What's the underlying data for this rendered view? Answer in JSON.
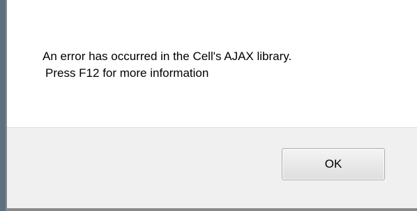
{
  "dialog": {
    "message_line1": "An error has occurred in the Cell's AJAX library.",
    "message_line2": "Press F12 for more information",
    "ok_label": "OK"
  },
  "colors": {
    "dialog_background": "#ffffff",
    "footer_background": "#f0f0f0",
    "frame": "#8a8a8a"
  }
}
